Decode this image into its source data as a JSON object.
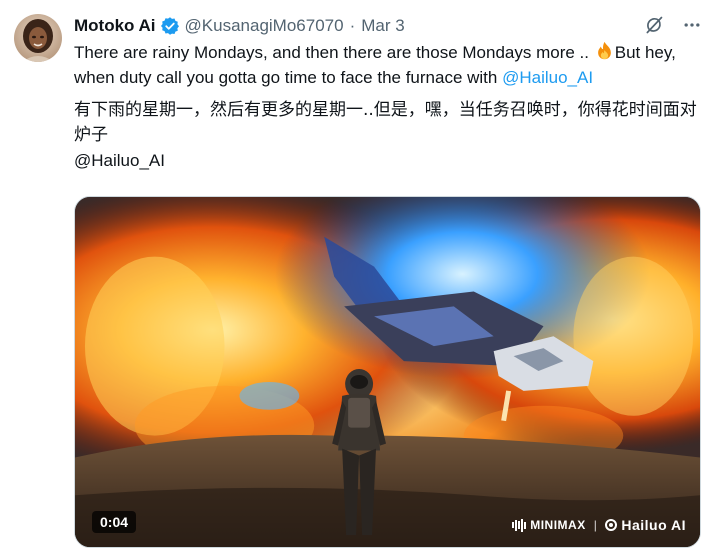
{
  "tweet": {
    "author_name": "Motoko Ai",
    "handle": "@KusanagiMo67070",
    "separator": "·",
    "date": "Mar 3",
    "text_en_part1": "There are rainy Mondays, and then there are those Mondays more .. ",
    "text_en_part2": "But hey, when duty call you gotta go time to face the furnace with ",
    "mention": "@Hailuo_AI",
    "text_zh": "有下雨的星期一，然后有更多的星期一..但是，嘿，当任务召唤时，你得花时间面对炉子",
    "mention_line": "@Hailuo_AI"
  },
  "media": {
    "timestamp": "0:04",
    "watermark_minimax": "MINIMAX",
    "watermark_separator": "|",
    "watermark_hailuo": "Hailuo AI"
  },
  "icons": {
    "verified": "verified-badge-icon",
    "grok": "grok-icon",
    "more": "more-icon",
    "fire": "fire-emoji-icon"
  },
  "colors": {
    "accent": "#1d9bf0",
    "text": "#0f1419",
    "secondary": "#536471"
  }
}
